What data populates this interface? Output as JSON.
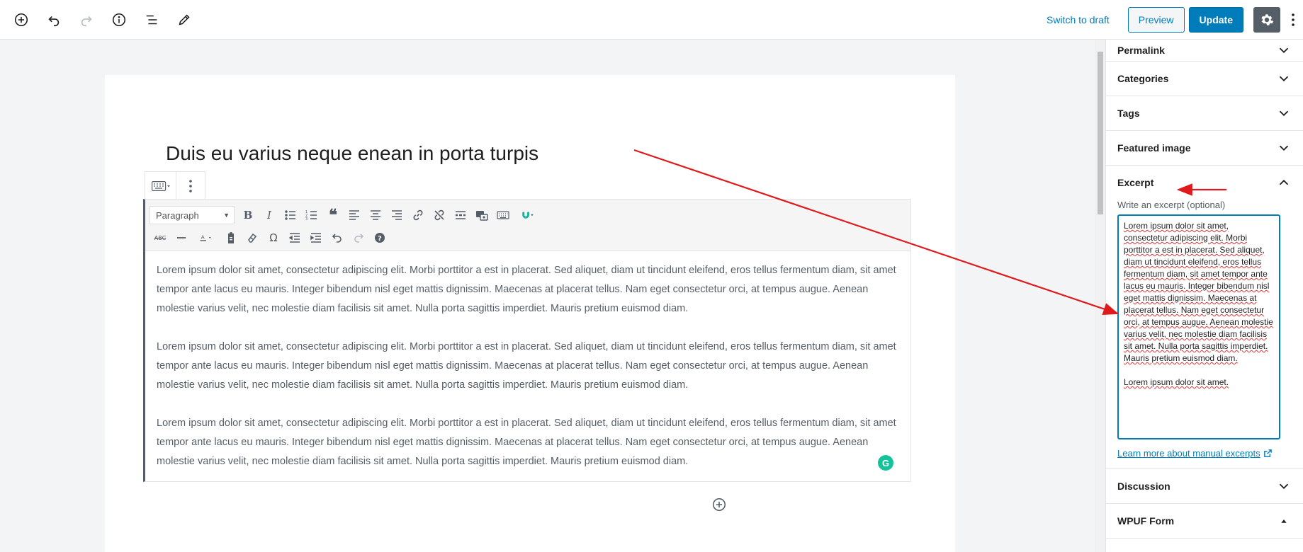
{
  "toolbar": {
    "switch_to_draft": "Switch to draft",
    "preview": "Preview",
    "update": "Update"
  },
  "post": {
    "title": "Duis eu varius neque enean in porta turpis"
  },
  "classic": {
    "format_select": "Paragraph",
    "paragraphs": [
      "Lorem ipsum dolor sit amet, consectetur adipiscing elit. Morbi porttitor a est in placerat. Sed aliquet, diam ut tincidunt eleifend, eros tellus fermentum diam, sit amet tempor ante lacus eu mauris. Integer bibendum nisl eget mattis dignissim. Maecenas at placerat tellus. Nam eget consectetur orci, at tempus augue. Aenean molestie varius velit, nec molestie diam facilisis sit amet. Nulla porta sagittis imperdiet. Mauris pretium euismod diam.",
      "Lorem ipsum dolor sit amet, consectetur adipiscing elit. Morbi porttitor a est in placerat. Sed aliquet, diam ut tincidunt eleifend, eros tellus fermentum diam, sit amet tempor ante lacus eu mauris. Integer bibendum nisl eget mattis dignissim. Maecenas at placerat tellus. Nam eget consectetur orci, at tempus augue. Aenean molestie varius velit, nec molestie diam facilisis sit amet. Nulla porta sagittis imperdiet. Mauris pretium euismod diam.",
      "Lorem ipsum dolor sit amet, consectetur adipiscing elit. Morbi porttitor a est in placerat. Sed aliquet, diam ut tincidunt eleifend, eros tellus fermentum diam, sit amet tempor ante lacus eu mauris. Integer bibendum nisl eget mattis dignissim. Maecenas at placerat tellus. Nam eget consectetur orci, at tempus augue. Aenean molestie varius velit, nec molestie diam facilisis sit amet. Nulla porta sagittis imperdiet. Mauris pretium euismod diam."
    ]
  },
  "sidebar": {
    "permalink": "Permalink",
    "categories": "Categories",
    "tags": "Tags",
    "featured_image": "Featured image",
    "excerpt": "Excerpt",
    "excerpt_label": "Write an excerpt (optional)",
    "excerpt_value": "Lorem ipsum dolor sit amet, consectetur adipiscing elit. Morbi porttitor a est in placerat. Sed aliquet, diam ut tincidunt eleifend, eros tellus fermentum diam, sit amet tempor ante lacus eu mauris. Integer bibendum nisl eget mattis dignissim. Maecenas at placerat tellus. Nam eget consectetur orci, at tempus augue. Aenean molestie varius velit, nec molestie diam facilisis sit amet. Nulla porta sagittis imperdiet. Mauris pretium euismod diam.",
    "excerpt_value_2": "Lorem ipsum dolor sit amet.",
    "excerpt_link": "Learn more about manual excerpts",
    "discussion": "Discussion",
    "wpuf_form": "WPUF Form"
  },
  "annotation": {
    "arrow_color": "#e0191c"
  },
  "colors": {
    "accent": "#007cba",
    "gear_bg": "#555d66",
    "grammarly": "#15c39a"
  }
}
